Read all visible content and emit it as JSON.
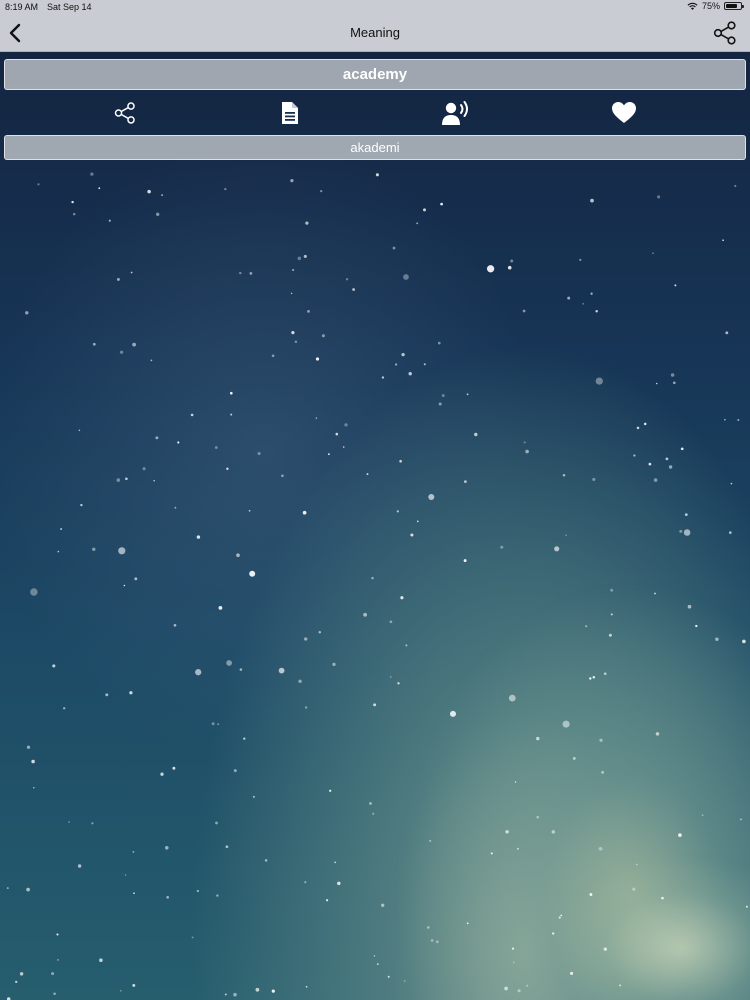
{
  "status_bar": {
    "time": "8:19 AM",
    "date": "Sat Sep 14",
    "battery_percent": "75%",
    "battery_level": 0.75,
    "wifi_icon": "wifi-icon",
    "battery_icon": "battery-icon"
  },
  "nav": {
    "title": "Meaning",
    "back_icon": "chevron-left-icon",
    "share_icon": "share-icon"
  },
  "word": "academy",
  "actions": [
    {
      "name": "share",
      "icon": "share-icon"
    },
    {
      "name": "document",
      "icon": "document-icon"
    },
    {
      "name": "speak",
      "icon": "speaker-person-icon"
    },
    {
      "name": "favorite",
      "icon": "heart-icon"
    }
  ],
  "meaning": "akademi",
  "colors": {
    "bar_background": "#c9ccd2",
    "panel_text": "#ffffff"
  }
}
